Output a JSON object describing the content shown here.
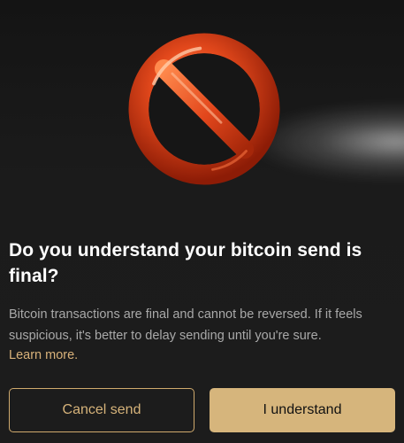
{
  "dialog": {
    "title": "Do you understand your bitcoin send is final?",
    "body": "Bitcoin transactions are final and cannot be reversed. If it feels suspicious, it's better to delay sending until you're sure.",
    "learn_more": "Learn more.",
    "illustration_icon": "prohibited-icon"
  },
  "buttons": {
    "cancel_label": "Cancel send",
    "confirm_label": "I understand"
  },
  "colors": {
    "accent": "#d6b57c",
    "background": "#1b1b1b",
    "icon": "#e0451f"
  }
}
